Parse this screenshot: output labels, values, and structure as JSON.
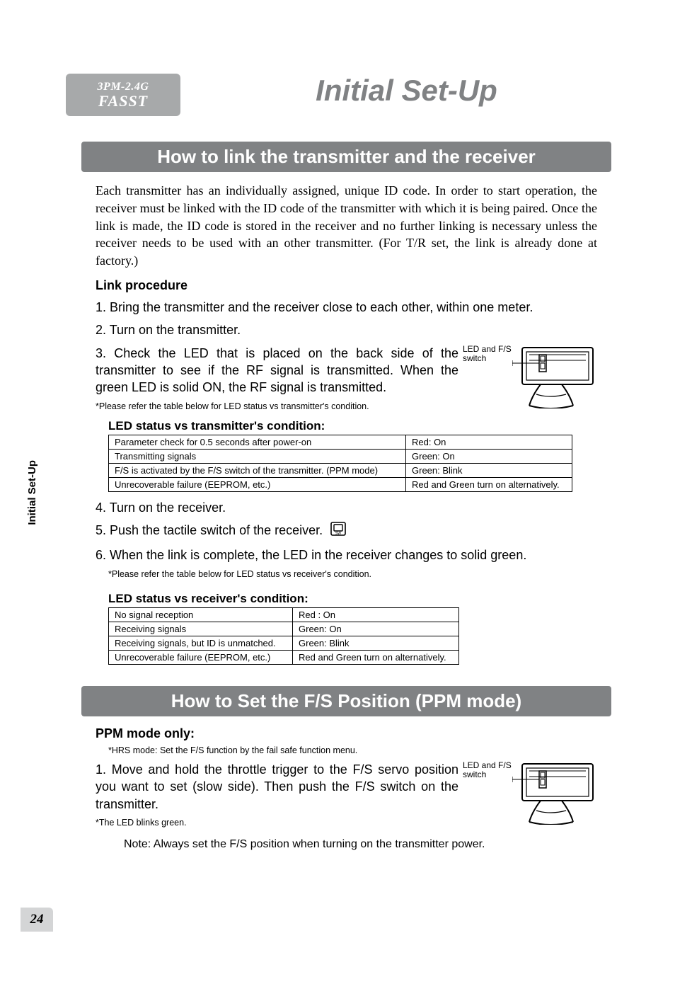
{
  "badge": {
    "top": "3PM-2.4G",
    "bot": "FASST"
  },
  "page_title": "Initial Set-Up",
  "side_tab": "Initial Set-Up",
  "page_number": "24",
  "section1": {
    "bar": "How to link the transmitter and the receiver",
    "intro": "Each transmitter has an individually assigned, unique ID code. In order to start operation, the receiver must be linked with the ID code of the transmitter with which it is being paired. Once the link is made, the ID code is stored in the receiver and no further linking is necessary unless the receiver needs to be used with an other transmitter. (For T/R set, the link is already done at factory.)",
    "link_procedure": "Link procedure",
    "steps": {
      "s1": "1. Bring the transmitter and the receiver close to each other, within one meter.",
      "s2": "2. Turn on the transmitter.",
      "s3": "3. Check the LED that is placed on the back side of the transmitter to see if the RF signal is transmitted. When the green LED is solid ON, the RF signal is transmitted.",
      "s3note": "*Please refer the table below for LED status vs transmitter's condition.",
      "s4": "4. Turn on the receiver.",
      "s5": "5. Push the tactile switch of the receiver.",
      "s6": "6. When the link is complete, the LED in the receiver changes to solid green.",
      "s6note": "*Please refer the table below for LED status vs receiver's condition."
    },
    "fig_label": "LED and F/S switch",
    "tx_table_title": "LED status vs transmitter's condition:",
    "tx_rows": [
      [
        "Parameter check for 0.5 seconds after power-on",
        "Red: On"
      ],
      [
        "Transmitting signals",
        "Green: On"
      ],
      [
        "F/S is activated by the F/S switch of the transmitter. (PPM mode)",
        "Green: Blink"
      ],
      [
        "Unrecoverable failure (EEPROM, etc.)",
        "Red and Green turn on alternatively."
      ]
    ],
    "rx_table_title": "LED status vs receiver's condition:",
    "rx_rows": [
      [
        "No signal reception",
        "Red : On"
      ],
      [
        "Receiving signals",
        "Green: On"
      ],
      [
        "Receiving signals, but ID is unmatched.",
        "Green: Blink"
      ],
      [
        "Unrecoverable failure (EEPROM, etc.)",
        "Red and Green turn on alternatively."
      ]
    ]
  },
  "section2": {
    "bar": "How to Set the F/S Position (PPM mode)",
    "sub": "PPM mode only:",
    "subnote": "*HRS mode: Set the F/S function by the fail safe function menu.",
    "step1": "1. Move and hold the throttle trigger to the F/S servo position you want to set (slow side). Then push the F/S switch on the transmitter.",
    "step1note": "*The LED blinks green.",
    "fig_label": "LED and F/S switch",
    "note": "Note: Always set the F/S position when turning on the transmitter power."
  }
}
